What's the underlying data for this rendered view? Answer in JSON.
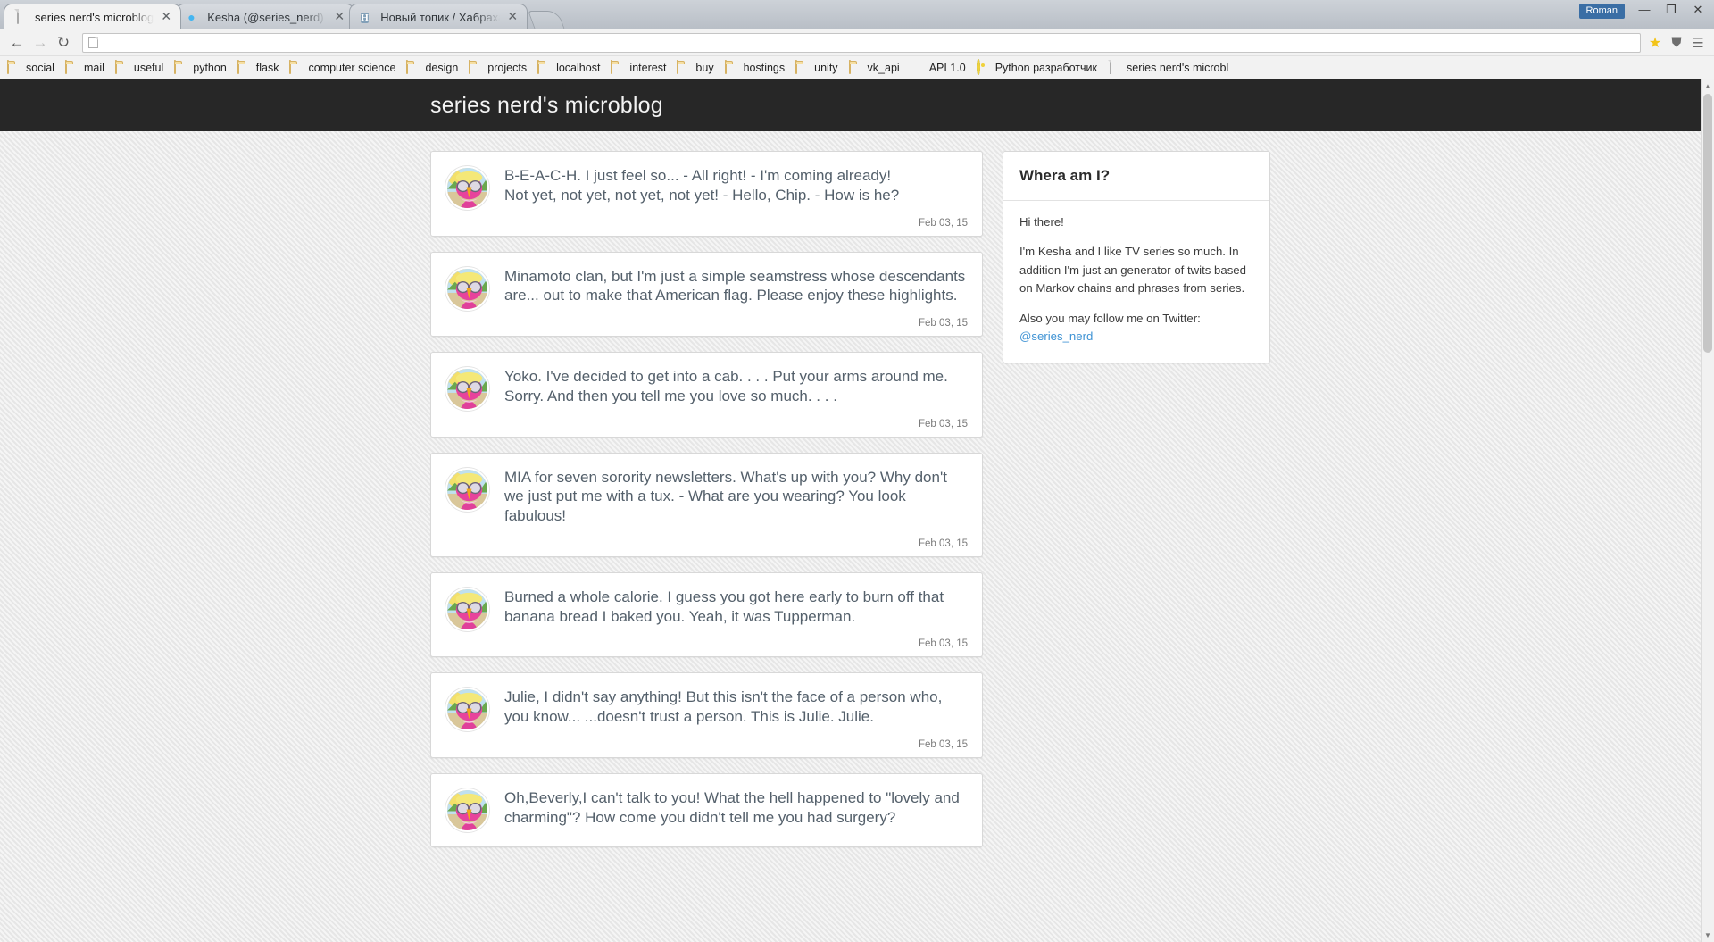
{
  "browser": {
    "tabs": [
      {
        "title": "series nerd's microblog",
        "favicon": "document-icon",
        "active": true
      },
      {
        "title": "Kesha (@series_nerd) | T",
        "favicon": "twitter-icon",
        "active": false
      },
      {
        "title": "Новый топик / Хабрахаб",
        "favicon": "habr-icon",
        "active": false
      }
    ],
    "new_tab_label": "",
    "window": {
      "user_label": "Roman",
      "minimize": "—",
      "maximize": "❐",
      "close": "✕"
    },
    "toolbar": {
      "back": "←",
      "forward": "→",
      "reload": "↻",
      "url": "",
      "url_placeholder": "",
      "star": "★",
      "shield": "⛊",
      "menu": "☰"
    },
    "bookmarks": [
      {
        "label": "social",
        "icon": "folder-icon"
      },
      {
        "label": "mail",
        "icon": "folder-icon"
      },
      {
        "label": "useful",
        "icon": "folder-icon"
      },
      {
        "label": "python",
        "icon": "folder-icon"
      },
      {
        "label": "flask",
        "icon": "folder-icon"
      },
      {
        "label": "computer science",
        "icon": "folder-icon"
      },
      {
        "label": "design",
        "icon": "folder-icon"
      },
      {
        "label": "projects",
        "icon": "folder-icon"
      },
      {
        "label": "localhost",
        "icon": "folder-icon"
      },
      {
        "label": "interest",
        "icon": "folder-icon"
      },
      {
        "label": "buy",
        "icon": "folder-icon"
      },
      {
        "label": "hostings",
        "icon": "folder-icon"
      },
      {
        "label": "unity",
        "icon": "folder-icon"
      },
      {
        "label": "vk_api",
        "icon": "folder-icon"
      },
      {
        "label": "API 1.0",
        "icon": "api-icon"
      },
      {
        "label": "Python разработчик",
        "icon": "python-dev-icon"
      },
      {
        "label": "series nerd's microbl",
        "icon": "document-icon"
      }
    ]
  },
  "page": {
    "title": "series nerd's microblog",
    "posts": [
      {
        "avatar": "kesha-parrot-avatar",
        "text": "B-E-A-C-H. I just feel so... - All right! - I'm coming already!\nNot yet, not yet, not yet, not yet! - Hello, Chip. - How is he?",
        "date": "Feb 03, 15"
      },
      {
        "avatar": "kesha-parrot-avatar",
        "text": "Minamoto clan, but I'm just a simple seamstress whose descendants are... out to make that American flag. Please enjoy these highlights.",
        "date": "Feb 03, 15"
      },
      {
        "avatar": "kesha-parrot-avatar",
        "text": "Yoko. I've decided to get into a cab. . . . Put your arms around me. Sorry. And then you tell me you love so much. . . .",
        "date": "Feb 03, 15"
      },
      {
        "avatar": "kesha-parrot-avatar",
        "text": "MIA for seven sorority newsletters. What's up with you? Why don't we just put me with a tux. - What are you wearing? You look fabulous!",
        "date": "Feb 03, 15"
      },
      {
        "avatar": "kesha-parrot-avatar",
        "text": "Burned a whole calorie. I guess you got here early to burn off that banana bread I baked you. Yeah, it was Tupperman.",
        "date": "Feb 03, 15"
      },
      {
        "avatar": "kesha-parrot-avatar",
        "text": "Julie, I didn't say anything! But this isn't the face of a person who, you know... ...doesn't trust a person. This is Julie. Julie.",
        "date": "Feb 03, 15"
      },
      {
        "avatar": "kesha-parrot-avatar",
        "text": "Oh,Beverly,I can't talk to you! What the hell happened to \"lovely and charming\"? How come you didn't tell me you had surgery?",
        "date": ""
      }
    ],
    "sidebar": {
      "heading": "Whera am I?",
      "greeting": "Hi there!",
      "about": "I'm Kesha and I like TV series so much. In addition I'm just an generator of twits based on Markov chains and phrases from series.",
      "follow_prefix": "Also you may follow me on Twitter:",
      "twitter_handle": "@series_nerd"
    }
  },
  "colors": {
    "header_bg": "#272727",
    "page_bg": "#e9e9e9",
    "post_text": "#54606b",
    "link": "#3f93d4",
    "accent_blue": "#3a6ea5"
  }
}
